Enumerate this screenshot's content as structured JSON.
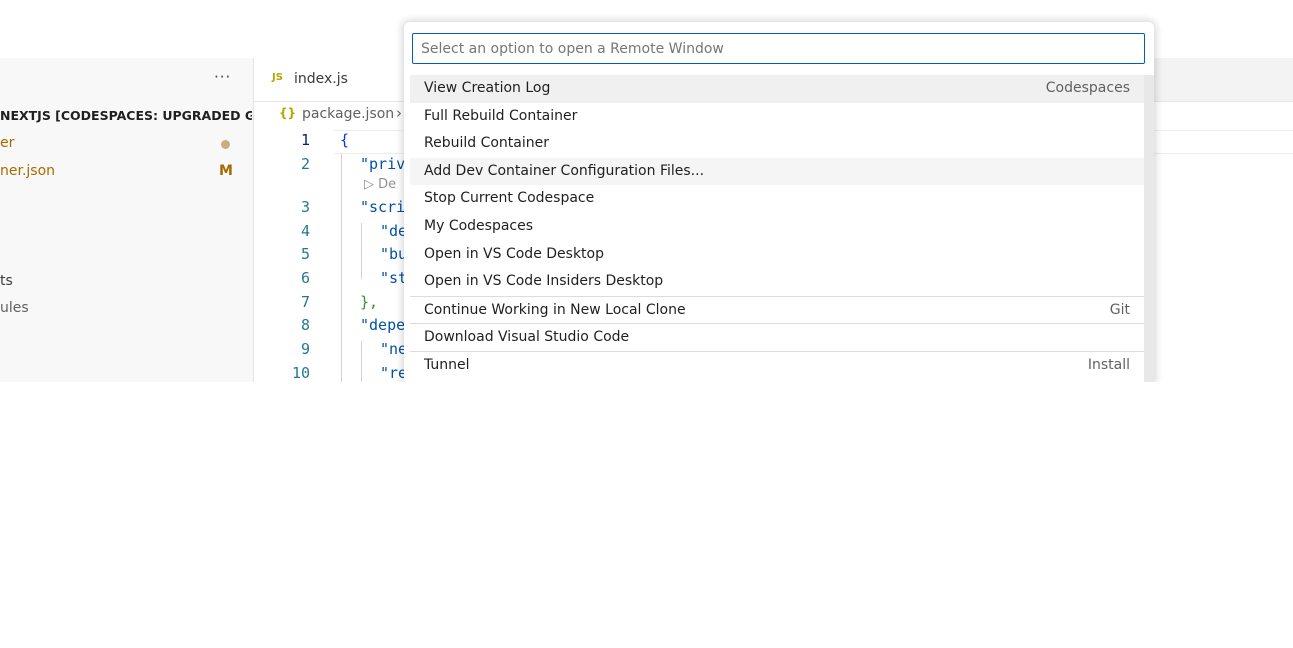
{
  "top_strip": {
    "cut_text": "                  "
  },
  "sidebar": {
    "more_label": "···",
    "title": "NEXTJS [CODESPACES: UPGRADED G...",
    "items": [
      {
        "label": "er",
        "status": "dot"
      },
      {
        "label": "ner.json",
        "status": "M"
      },
      {
        "label": "ts",
        "status": ""
      },
      {
        "label": "ules",
        "status": ""
      }
    ]
  },
  "editor": {
    "tab": {
      "icon": "JS",
      "label": "index.js"
    },
    "breadcrumb": {
      "icon": "{}",
      "file": "package.json",
      "separator": "›"
    },
    "lines": [
      {
        "num": "1",
        "text": "{"
      },
      {
        "num": "2",
        "text": "\"priv"
      },
      {
        "num": "3",
        "text": "\"scri"
      },
      {
        "num": "4",
        "text": "\"de"
      },
      {
        "num": "5",
        "text": "\"bu"
      },
      {
        "num": "6",
        "text": "\"st"
      },
      {
        "num": "7",
        "text": "},"
      },
      {
        "num": "8",
        "text": "\"depe"
      },
      {
        "num": "9",
        "text": "\"ne"
      },
      {
        "num": "10",
        "text": "\"re"
      }
    ],
    "codelens": "▷ De"
  },
  "quickpick": {
    "placeholder": "Select an option to open a Remote Window",
    "items": [
      {
        "label": "View Creation Log",
        "detail": "Codespaces"
      },
      {
        "label": "Full Rebuild Container",
        "detail": ""
      },
      {
        "label": "Rebuild Container",
        "detail": ""
      },
      {
        "label": "Add Dev Container Configuration Files...",
        "detail": ""
      },
      {
        "label": "Stop Current Codespace",
        "detail": ""
      },
      {
        "label": "My Codespaces",
        "detail": ""
      },
      {
        "label": "Open in VS Code Desktop",
        "detail": ""
      },
      {
        "label": "Open in VS Code Insiders Desktop",
        "detail": ""
      },
      {
        "label": "Continue Working in New Local Clone",
        "detail": "Git"
      },
      {
        "label": "Download Visual Studio Code",
        "detail": ""
      },
      {
        "label": "Tunnel",
        "detail": "Install"
      }
    ]
  },
  "colors": {
    "accent": "#005fb8",
    "modified": "#a66b00",
    "line_number": "#237893"
  }
}
